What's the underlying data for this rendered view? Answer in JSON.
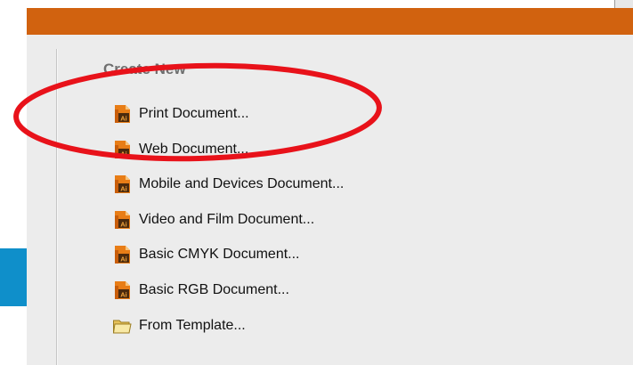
{
  "panel": {
    "heading": "Create New",
    "items": [
      {
        "label": "Print Document...",
        "icon": "illustrator-doc-icon"
      },
      {
        "label": "Web Document...",
        "icon": "illustrator-doc-icon"
      },
      {
        "label": "Mobile and Devices Document...",
        "icon": "illustrator-doc-icon"
      },
      {
        "label": "Video and Film Document...",
        "icon": "illustrator-doc-icon"
      },
      {
        "label": "Basic CMYK Document...",
        "icon": "illustrator-doc-icon"
      },
      {
        "label": "Basic RGB Document...",
        "icon": "illustrator-doc-icon"
      },
      {
        "label": "From Template...",
        "icon": "folder-icon"
      }
    ]
  },
  "colors": {
    "header_bar": "#d1620f",
    "panel_bg": "#ececec",
    "side_accent": "#0f8fca",
    "annotation": "#e8121a",
    "icon_orange": "#e87d16"
  },
  "icon_text": "Ai"
}
